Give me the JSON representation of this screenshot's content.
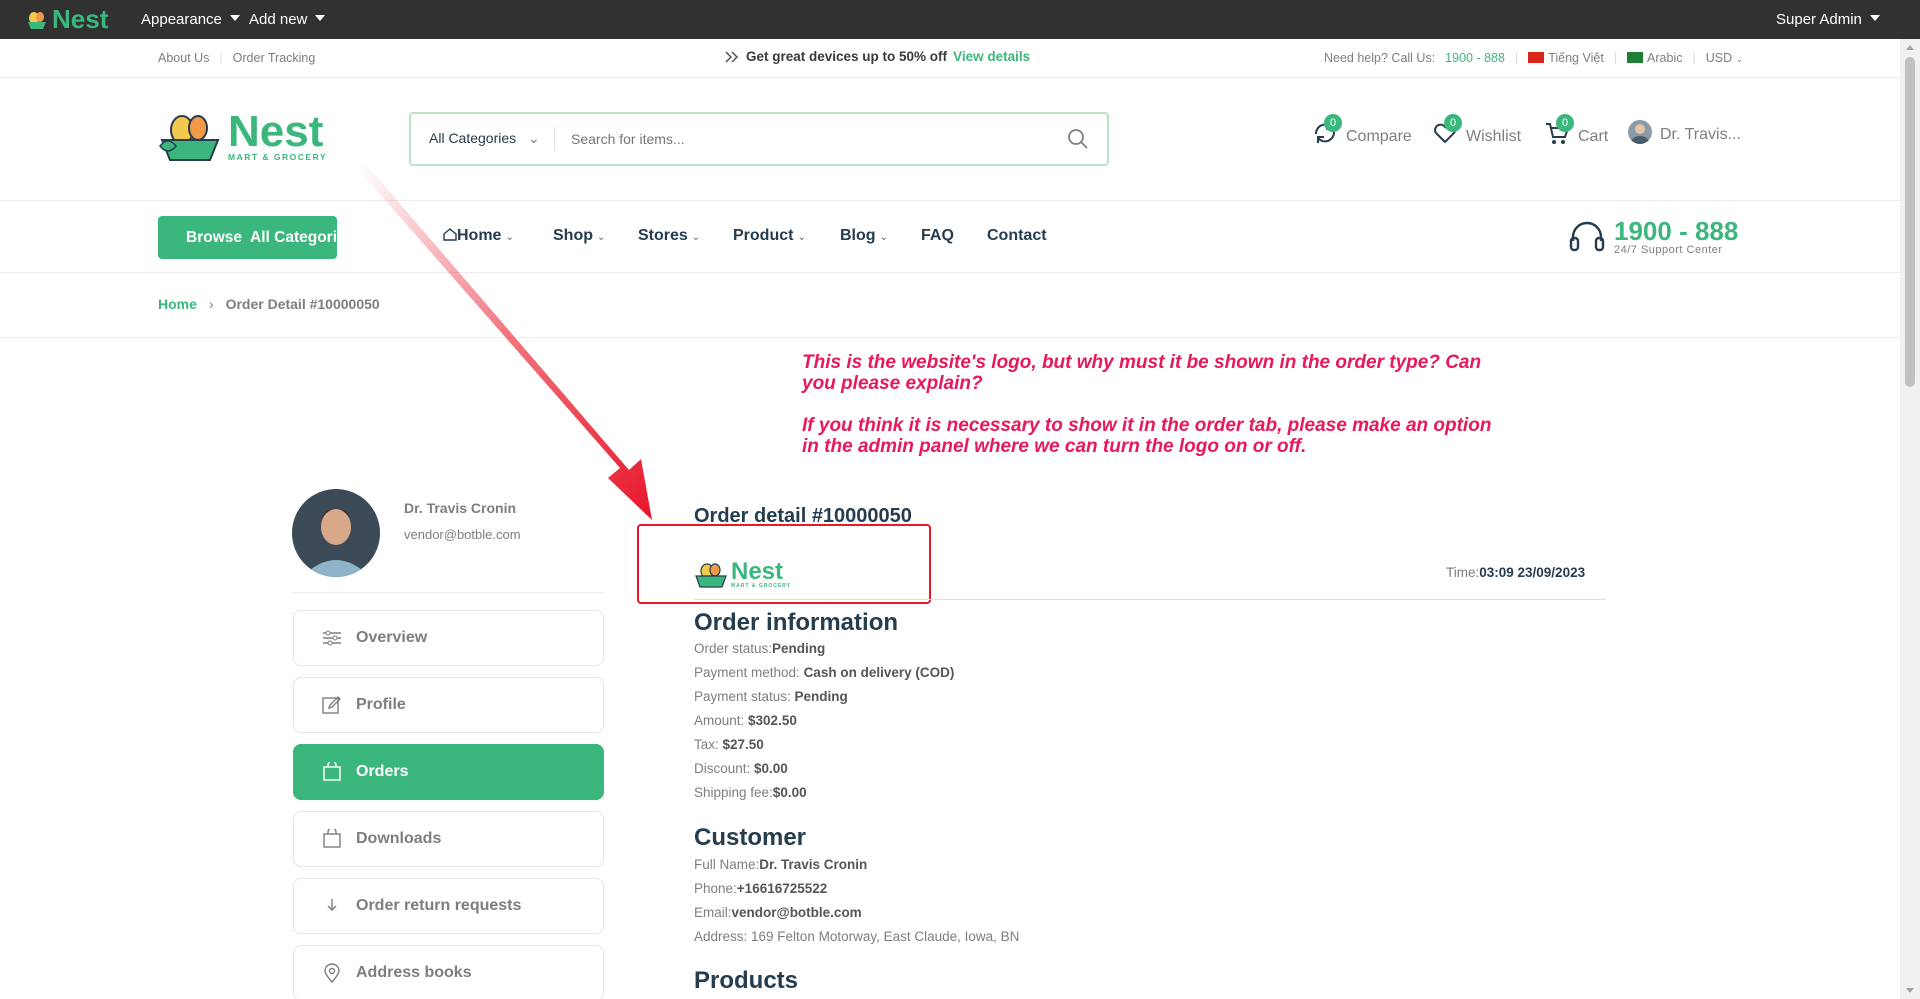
{
  "adminbar": {
    "logo": "Nest",
    "menu": [
      "Appearance",
      "Add new"
    ],
    "user": "Super Admin"
  },
  "topbar": {
    "links": [
      "About Us",
      "Order Tracking"
    ],
    "promo": "Get great devices up to 50% off",
    "promo_link": "View details",
    "help_label": "Need help? Call Us:",
    "help_phone": "1900 - 888",
    "lang_vi": "Tiếng Việt",
    "lang_ar": "Arabic",
    "currency": "USD"
  },
  "header": {
    "brand_word": "Nest",
    "brand_sub": "MART & GROCERY",
    "search": {
      "category": "All Categories",
      "placeholder": "Search for items..."
    },
    "actions": {
      "compare": {
        "label": "Compare",
        "count": "0"
      },
      "wishlist": {
        "label": "Wishlist",
        "count": "0"
      },
      "cart": {
        "label": "Cart",
        "count": "0"
      },
      "account": {
        "label": "Dr. Travis..."
      }
    }
  },
  "nav": {
    "browse": "Browse  All Categories",
    "items": [
      "Home",
      "Shop",
      "Stores",
      "Product",
      "Blog",
      "FAQ",
      "Contact"
    ],
    "support_phone": "1900 - 888",
    "support_text": "24/7 Support Center"
  },
  "breadcrumb": {
    "home": "Home",
    "current": "Order Detail #10000050"
  },
  "annotation": {
    "p1": "This is the website's logo, but why must it be shown in the order type? Can you please explain?",
    "p2": "If you think it is necessary to show it in the order tab, please make an option in the admin panel where we can turn the logo on or off."
  },
  "sidebar": {
    "name": "Dr. Travis Cronin",
    "email": "vendor@botble.com",
    "items": [
      "Overview",
      "Profile",
      "Orders",
      "Downloads",
      "Order return requests",
      "Address books"
    ]
  },
  "order": {
    "title": "Order detail #10000050",
    "time_label": "Time:",
    "time_value": "03:09 23/09/2023",
    "info_heading": "Order information",
    "info": [
      {
        "label": "Order status:",
        "value": "Pending"
      },
      {
        "label": "Payment method: ",
        "value": "Cash on delivery (COD)"
      },
      {
        "label": "Payment status: ",
        "value": "Pending"
      },
      {
        "label": "Amount: ",
        "value": "$302.50"
      },
      {
        "label": "Tax: ",
        "value": "$27.50"
      },
      {
        "label": "Discount: ",
        "value": "$0.00"
      },
      {
        "label": "Shipping fee:",
        "value": "$0.00"
      }
    ],
    "customer_heading": "Customer",
    "customer": [
      {
        "label": "Full Name:",
        "value": "Dr. Travis Cronin"
      },
      {
        "label": "Phone:",
        "value": "+16616725522"
      },
      {
        "label": "Email:",
        "value": "vendor@botble.com"
      },
      {
        "label": "Address: 169 Felton Motorway, East Claude, Iowa, BN",
        "value": ""
      }
    ],
    "products_heading": "Products"
  },
  "colors": {
    "brand": "#3bb77e",
    "annotation": "#e8195a",
    "arrow": "#e8192c",
    "adminbar": "#313131"
  }
}
